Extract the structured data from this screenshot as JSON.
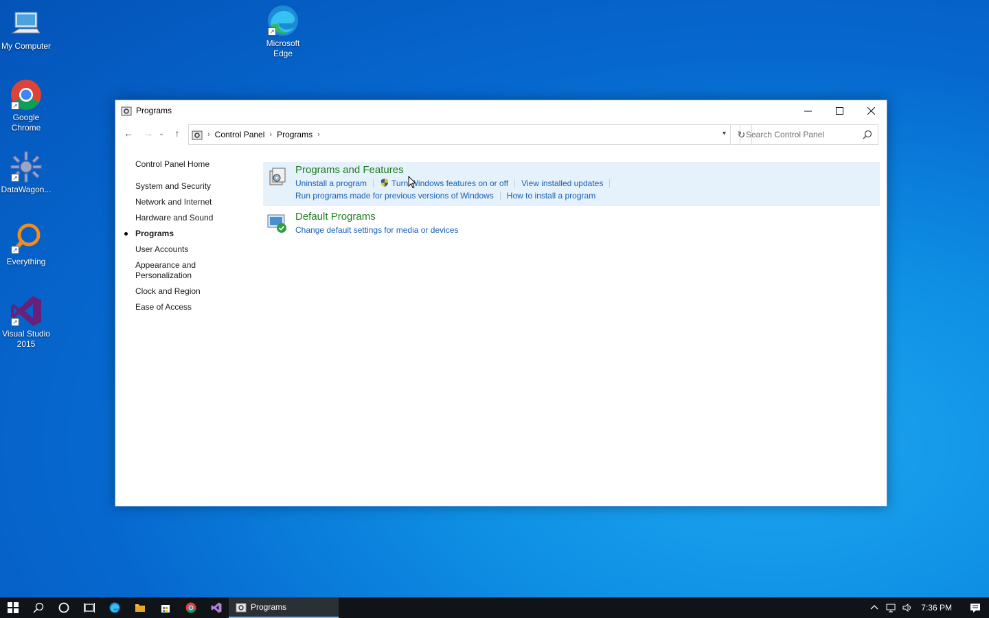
{
  "desktop": {
    "icons": [
      {
        "label": "My Computer",
        "icon": "computer-icon"
      },
      {
        "label": "Google Chrome",
        "icon": "chrome-icon"
      },
      {
        "label": "DataWagon...",
        "icon": "datawagon-icon"
      },
      {
        "label": "Everything",
        "icon": "everything-search-icon"
      },
      {
        "label": "Visual Studio 2015",
        "icon": "visual-studio-icon"
      },
      {
        "label": "Microsoft Edge",
        "icon": "edge-icon"
      }
    ]
  },
  "window": {
    "title": "Programs",
    "breadcrumb": [
      "Control Panel",
      "Programs"
    ],
    "search_placeholder": "Search Control Panel",
    "left_nav": {
      "home": "Control Panel Home",
      "categories": [
        {
          "label": "System and Security",
          "active": false
        },
        {
          "label": "Network and Internet",
          "active": false
        },
        {
          "label": "Hardware and Sound",
          "active": false
        },
        {
          "label": "Programs",
          "active": true
        },
        {
          "label": "User Accounts",
          "active": false
        },
        {
          "label": "Appearance and Personalization",
          "active": false
        },
        {
          "label": "Clock and Region",
          "active": false
        },
        {
          "label": "Ease of Access",
          "active": false
        }
      ]
    },
    "groups": [
      {
        "title": "Programs and Features",
        "links_row1": [
          "Uninstall a program",
          "Turn Windows features on or off",
          "View installed updates"
        ],
        "links_row2": [
          "Run programs made for previous versions of Windows",
          "How to install a program"
        ]
      },
      {
        "title": "Default Programs",
        "links_row1": [
          "Change default settings for media or devices"
        ]
      }
    ]
  },
  "taskbar": {
    "task_label": "Programs",
    "clock": "7:36 PM"
  },
  "colors": {
    "link": "#1a5fb4",
    "group_title": "#1e7b1e",
    "hover_bg": "#e5f1fb",
    "taskbar": "#101418"
  }
}
